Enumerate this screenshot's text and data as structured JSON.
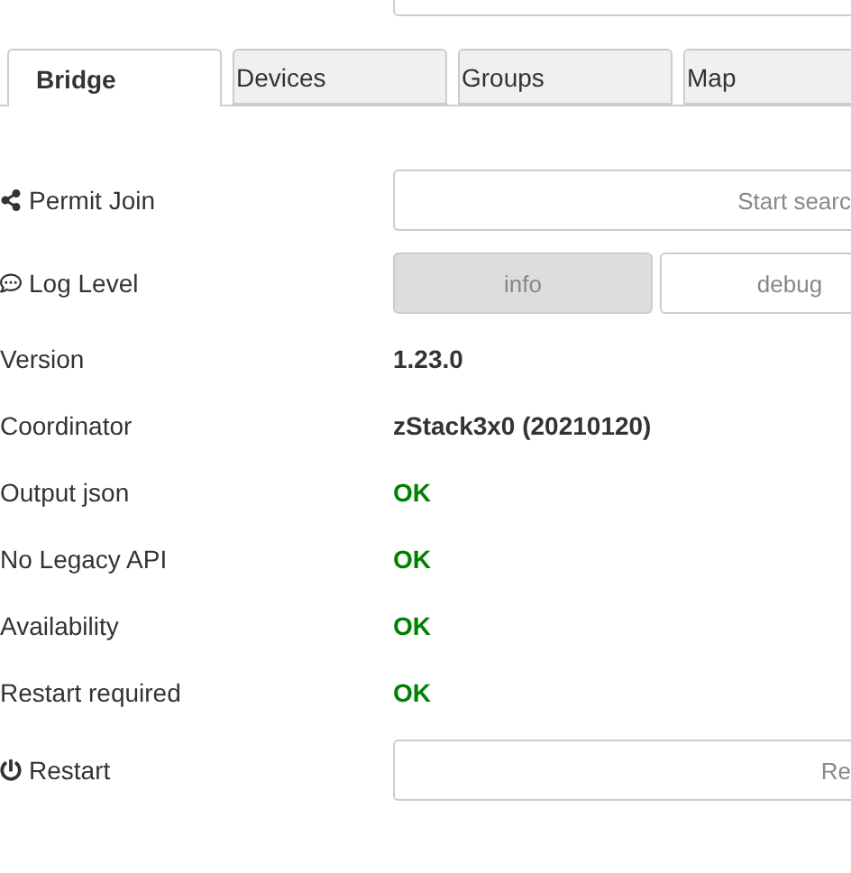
{
  "tabs": [
    {
      "label": "Bridge",
      "selected": true
    },
    {
      "label": "Devices",
      "selected": false
    },
    {
      "label": "Groups",
      "selected": false
    },
    {
      "label": "Map",
      "selected": false
    }
  ],
  "rows": [
    {
      "kind": "join",
      "label": "Permit Join",
      "button": "Start searc"
    },
    {
      "kind": "loglevel",
      "label": "Log Level",
      "options": [
        {
          "label": "info",
          "selected": true
        },
        {
          "label": "debug",
          "selected": false
        }
      ]
    },
    {
      "kind": "info",
      "label": "Version",
      "value": "1.23.0"
    },
    {
      "kind": "info",
      "label": "Coordinator",
      "value": "zStack3x0 (20210120)"
    },
    {
      "kind": "status",
      "label": "Output json",
      "value": "OK"
    },
    {
      "kind": "status",
      "label": "No Legacy API",
      "value": "OK"
    },
    {
      "kind": "status",
      "label": "Availability",
      "value": "OK"
    },
    {
      "kind": "status",
      "label": "Restart required",
      "value": "OK"
    },
    {
      "kind": "restart",
      "label": "Restart",
      "button": "Re"
    }
  ]
}
